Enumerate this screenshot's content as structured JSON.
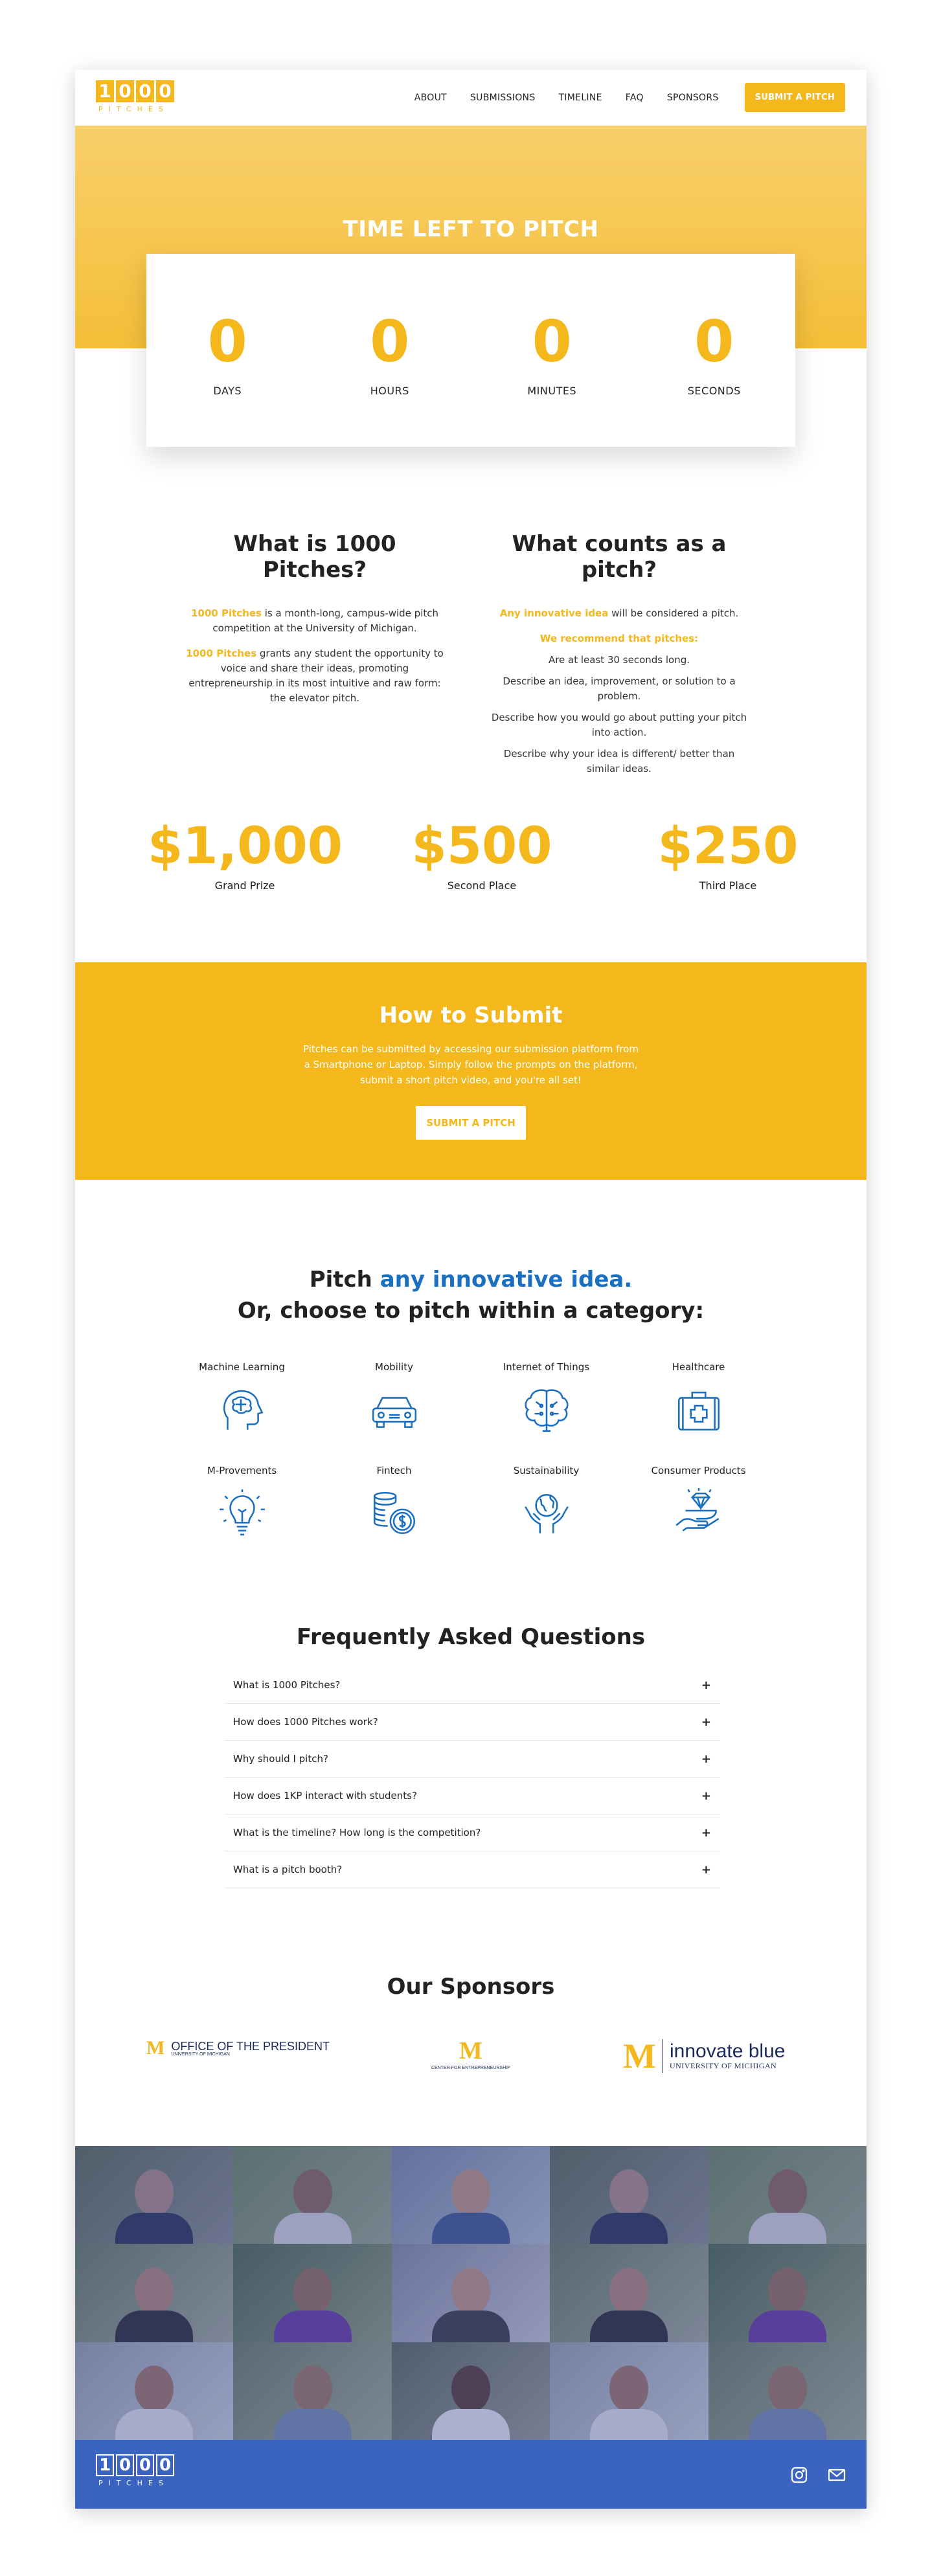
{
  "header": {
    "logo_digits": [
      "1",
      "0",
      "0",
      "0"
    ],
    "logo_sub": "PITCHES",
    "nav": [
      "ABOUT",
      "SUBMISSIONS",
      "TIMELINE",
      "FAQ",
      "SPONSORS"
    ],
    "cta": "SUBMIT A PITCH"
  },
  "countdown": {
    "title": "TIME LEFT TO PITCH",
    "units": [
      {
        "value": "0",
        "label": "DAYS"
      },
      {
        "value": "0",
        "label": "HOURS"
      },
      {
        "value": "0",
        "label": "MINUTES"
      },
      {
        "value": "0",
        "label": "SECONDS"
      }
    ]
  },
  "about": {
    "left_title": "What is 1000 Pitches?",
    "left_p1_hl": "1000 Pitches",
    "left_p1": " is a month-long, campus-wide pitch competition at the University of Michigan.",
    "left_p2_hl": "1000 Pitches",
    "left_p2": " grants any student the opportunity to voice and share their ideas, promoting entrepreneurship in its most intuitive and raw form: the elevator pitch.",
    "right_title": "What counts as a pitch?",
    "right_p1_hl": "Any innovative idea",
    "right_p1": " will be considered a pitch.",
    "recommend": "We recommend that pitches:",
    "bullets": [
      "Are at least 30 seconds long.",
      "Describe an idea, improvement, or solution to a problem.",
      "Describe how you would go about putting your pitch into action.",
      "Describe why your idea is different/ better than similar ideas."
    ]
  },
  "prizes": [
    {
      "amount": "$1,000",
      "label": "Grand Prize"
    },
    {
      "amount": "$500",
      "label": "Second Place"
    },
    {
      "amount": "$250",
      "label": "Third Place"
    }
  ],
  "how": {
    "title": "How to Submit",
    "text": "Pitches can be submitted by accessing our submission platform from a Smartphone or Laptop. Simply follow the prompts on the platform, submit a short pitch video, and you're all set!",
    "button": "SUBMIT A PITCH"
  },
  "categories": {
    "title_prefix": "Pitch ",
    "title_highlight": "any innovative idea.",
    "title_line2": "Or, choose to pitch within a category:",
    "items": [
      {
        "label": "Machine Learning",
        "icon": "brain-head-icon"
      },
      {
        "label": "Mobility",
        "icon": "car-icon"
      },
      {
        "label": "Internet of Things",
        "icon": "circuit-brain-icon"
      },
      {
        "label": "Healthcare",
        "icon": "medical-kit-icon"
      },
      {
        "label": "M-Provements",
        "icon": "lightbulb-icon"
      },
      {
        "label": "Fintech",
        "icon": "coins-icon"
      },
      {
        "label": "Sustainability",
        "icon": "globe-hands-icon"
      },
      {
        "label": "Consumer Products",
        "icon": "hand-diamond-icon"
      }
    ],
    "icon_color": "#1a6fc0"
  },
  "faq": {
    "title": "Frequently Asked Questions",
    "items": [
      "What is 1000 Pitches?",
      "How does 1000 Pitches work?",
      "Why should I pitch?",
      "How does 1KP interact with students?",
      "What is the timeline? How long is the competition?",
      "What is a pitch booth?"
    ],
    "expand_symbol": "+"
  },
  "sponsors": {
    "title": "Our Sponsors",
    "logos": [
      {
        "mark": "M",
        "line1": "OFFICE OF THE PRESIDENT",
        "line2": "UNIVERSITY OF MICHIGAN"
      },
      {
        "mark": "M",
        "line1": "CENTER FOR ENTREPRENEURSHIP"
      },
      {
        "mark": "M",
        "line1": "innovate blue",
        "line2": "UNIVERSITY OF MICHIGAN"
      }
    ]
  },
  "footer": {
    "logo_digits": [
      "1",
      "0",
      "0",
      "0"
    ],
    "logo_sub": "PITCHES",
    "icons": [
      "instagram-icon",
      "mail-icon"
    ]
  },
  "colors": {
    "accent": "#f4b81c",
    "blue": "#1a6fc0",
    "footer": "#3a64c0"
  }
}
